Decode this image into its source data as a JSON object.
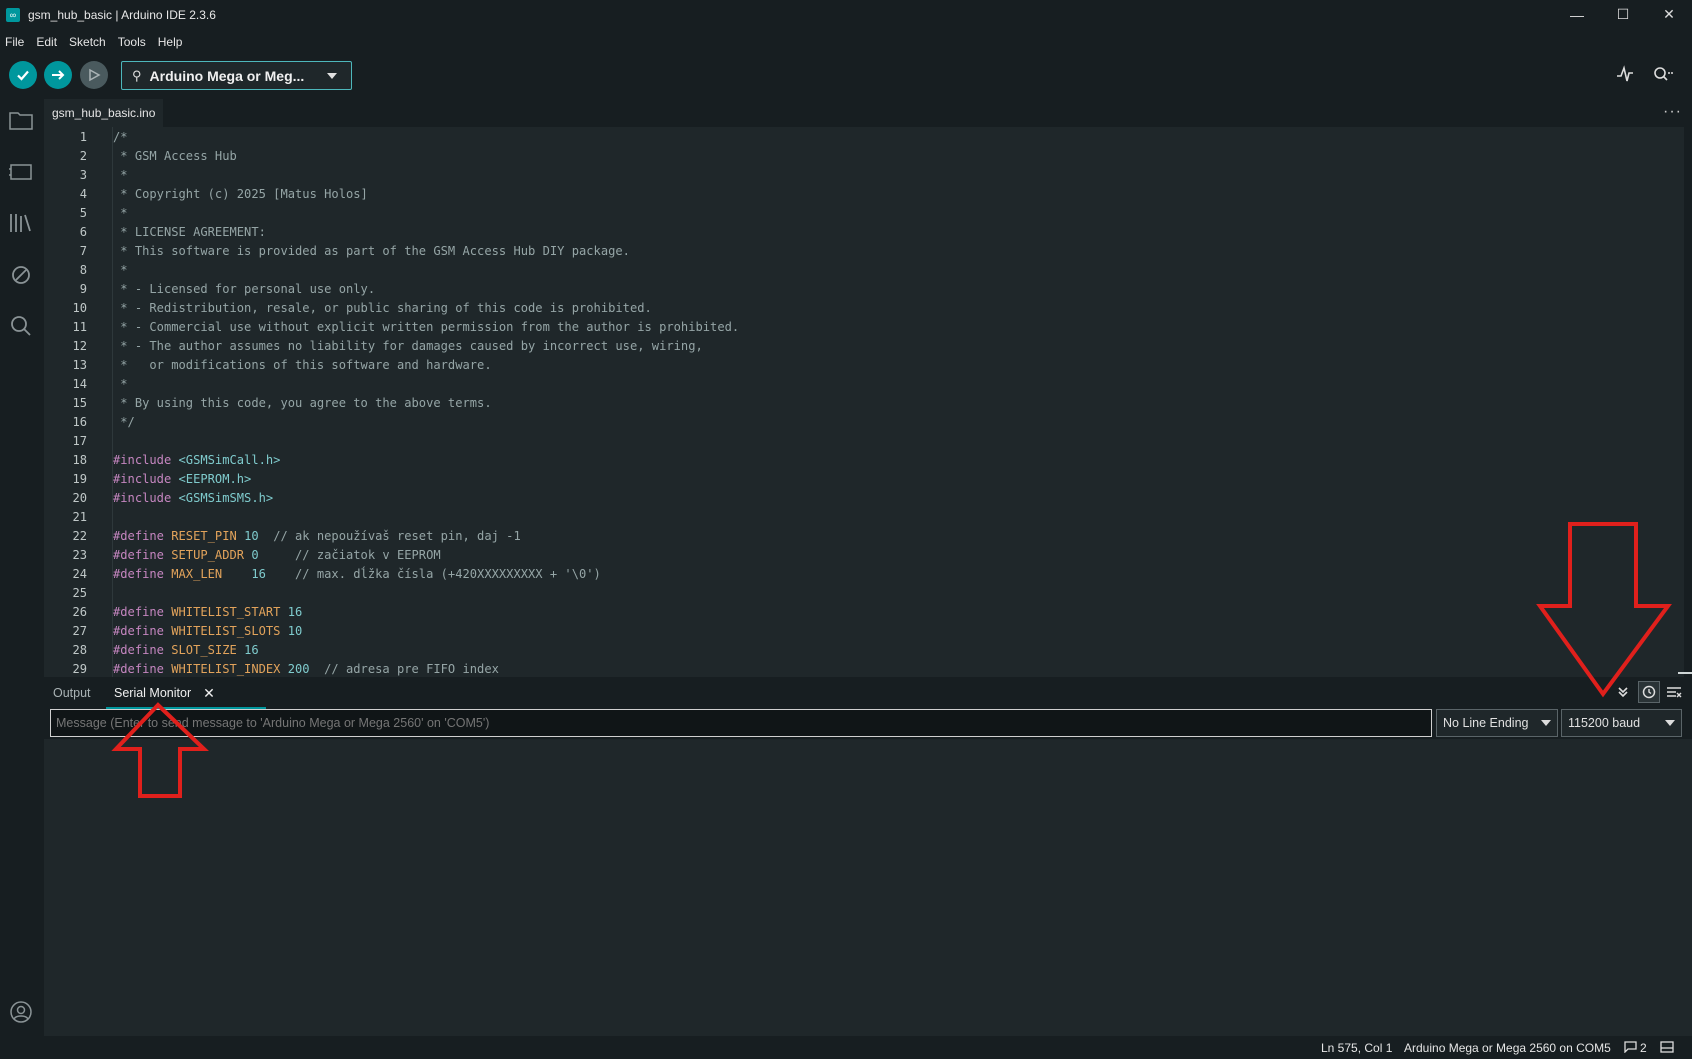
{
  "window": {
    "title": "gsm_hub_basic | Arduino IDE 2.3.6",
    "minimize": "—",
    "maximize": "☐",
    "close": "✕"
  },
  "menu": [
    "File",
    "Edit",
    "Sketch",
    "Tools",
    "Help"
  ],
  "toolbar": {
    "board": "Arduino Mega or Meg...",
    "verify_icon": "check-icon",
    "upload_icon": "arrow-right-icon",
    "debug_icon": "debug-icon",
    "plotter_icon": "serial-plotter-icon",
    "monitor_icon": "serial-monitor-icon"
  },
  "editor": {
    "tab": "gsm_hub_basic.ino",
    "lines": [
      {
        "n": "1",
        "parts": [
          [
            "c-comment",
            "/*"
          ]
        ]
      },
      {
        "n": "2",
        "parts": [
          [
            "c-comment",
            " * GSM Access Hub"
          ]
        ]
      },
      {
        "n": "3",
        "parts": [
          [
            "c-comment",
            " *"
          ]
        ]
      },
      {
        "n": "4",
        "parts": [
          [
            "c-comment",
            " * Copyright (c) 2025 [Matus Holos]"
          ]
        ]
      },
      {
        "n": "5",
        "parts": [
          [
            "c-comment",
            " *"
          ]
        ]
      },
      {
        "n": "6",
        "parts": [
          [
            "c-comment",
            " * LICENSE AGREEMENT:"
          ]
        ]
      },
      {
        "n": "7",
        "parts": [
          [
            "c-comment",
            " * This software is provided as part of the GSM Access Hub DIY package."
          ]
        ]
      },
      {
        "n": "8",
        "parts": [
          [
            "c-comment",
            " *"
          ]
        ]
      },
      {
        "n": "9",
        "parts": [
          [
            "c-comment",
            " * - Licensed for personal use only."
          ]
        ]
      },
      {
        "n": "10",
        "parts": [
          [
            "c-comment",
            " * - Redistribution, resale, or public sharing of this code is prohibited."
          ]
        ]
      },
      {
        "n": "11",
        "parts": [
          [
            "c-comment",
            " * - Commercial use without explicit written permission from the author is prohibited."
          ]
        ]
      },
      {
        "n": "12",
        "parts": [
          [
            "c-comment",
            " * - The author assumes no liability for damages caused by incorrect use, wiring,"
          ]
        ]
      },
      {
        "n": "13",
        "parts": [
          [
            "c-comment",
            " *   or modifications of this software and hardware."
          ]
        ]
      },
      {
        "n": "14",
        "parts": [
          [
            "c-comment",
            " *"
          ]
        ]
      },
      {
        "n": "15",
        "parts": [
          [
            "c-comment",
            " * By using this code, you agree to the above terms."
          ]
        ]
      },
      {
        "n": "16",
        "parts": [
          [
            "c-comment",
            " */"
          ]
        ]
      },
      {
        "n": "17",
        "parts": []
      },
      {
        "n": "18",
        "parts": [
          [
            "c-pp",
            "#include"
          ],
          [
            "",
            " "
          ],
          [
            "c-inc",
            "<GSMSimCall.h>"
          ]
        ]
      },
      {
        "n": "19",
        "parts": [
          [
            "c-pp",
            "#include"
          ],
          [
            "",
            " "
          ],
          [
            "c-inc",
            "<EEPROM.h>"
          ]
        ]
      },
      {
        "n": "20",
        "parts": [
          [
            "c-pp",
            "#include"
          ],
          [
            "",
            " "
          ],
          [
            "c-inc",
            "<GSMSimSMS.h>"
          ]
        ]
      },
      {
        "n": "21",
        "parts": []
      },
      {
        "n": "22",
        "parts": [
          [
            "c-pp",
            "#define"
          ],
          [
            "",
            " "
          ],
          [
            "c-name",
            "RESET_PIN"
          ],
          [
            "",
            " "
          ],
          [
            "c-num",
            "10"
          ],
          [
            "",
            "  "
          ],
          [
            "c-comment",
            "// ak nepoužívaš reset pin, daj -1"
          ]
        ]
      },
      {
        "n": "23",
        "parts": [
          [
            "c-pp",
            "#define"
          ],
          [
            "",
            " "
          ],
          [
            "c-name",
            "SETUP_ADDR"
          ],
          [
            "",
            " "
          ],
          [
            "c-num",
            "0"
          ],
          [
            "",
            "     "
          ],
          [
            "c-comment",
            "// začiatok v EEPROM"
          ]
        ]
      },
      {
        "n": "24",
        "parts": [
          [
            "c-pp",
            "#define"
          ],
          [
            "",
            " "
          ],
          [
            "c-name",
            "MAX_LEN"
          ],
          [
            "",
            "    "
          ],
          [
            "c-num",
            "16"
          ],
          [
            "",
            "    "
          ],
          [
            "c-comment",
            "// max. dĺžka čísla (+420XXXXXXXXX + '\\0')"
          ]
        ]
      },
      {
        "n": "25",
        "parts": []
      },
      {
        "n": "26",
        "parts": [
          [
            "c-pp",
            "#define"
          ],
          [
            "",
            " "
          ],
          [
            "c-name",
            "WHITELIST_START"
          ],
          [
            "",
            " "
          ],
          [
            "c-num",
            "16"
          ]
        ]
      },
      {
        "n": "27",
        "parts": [
          [
            "c-pp",
            "#define"
          ],
          [
            "",
            " "
          ],
          [
            "c-name",
            "WHITELIST_SLOTS"
          ],
          [
            "",
            " "
          ],
          [
            "c-num",
            "10"
          ]
        ]
      },
      {
        "n": "28",
        "parts": [
          [
            "c-pp",
            "#define"
          ],
          [
            "",
            " "
          ],
          [
            "c-name",
            "SLOT_SIZE"
          ],
          [
            "",
            " "
          ],
          [
            "c-num",
            "16"
          ]
        ]
      },
      {
        "n": "29",
        "parts": [
          [
            "c-pp",
            "#define"
          ],
          [
            "",
            " "
          ],
          [
            "c-name",
            "WHITELIST_INDEX"
          ],
          [
            "",
            " "
          ],
          [
            "c-num",
            "200"
          ],
          [
            "",
            "  "
          ],
          [
            "c-comment",
            "// adresa pre FIFO index"
          ]
        ]
      }
    ]
  },
  "panel": {
    "output_tab": "Output",
    "serial_tab": "Serial Monitor",
    "close": "✕",
    "message_placeholder": "Message (Enter to send message to 'Arduino Mega or Mega 2560' on 'COM5')",
    "line_ending": "No Line Ending",
    "baud": "115200 baud"
  },
  "status": {
    "position": "Ln 575, Col 1",
    "board_port": "Arduino Mega or Mega 2560 on COM5",
    "notifications": "2"
  },
  "annotation_color": "#e0201c"
}
